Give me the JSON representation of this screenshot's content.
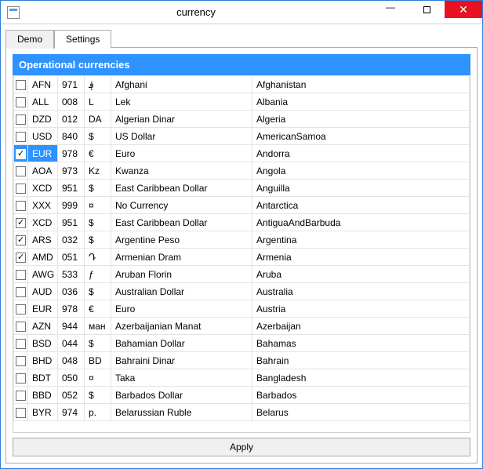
{
  "window": {
    "title": "currency"
  },
  "tabs": {
    "demo": "Demo",
    "settings": "Settings",
    "active": "settings"
  },
  "section": {
    "header": "Operational currencies"
  },
  "buttons": {
    "apply": "Apply"
  },
  "rows": [
    {
      "checked": false,
      "sel": false,
      "code": "AFN",
      "num": "971",
      "sym": "؋",
      "name": "Afghani",
      "country": "Afghanistan"
    },
    {
      "checked": false,
      "sel": false,
      "code": "ALL",
      "num": "008",
      "sym": "L",
      "name": "Lek",
      "country": "Albania"
    },
    {
      "checked": false,
      "sel": false,
      "code": "DZD",
      "num": "012",
      "sym": "DA",
      "name": "Algerian Dinar",
      "country": "Algeria"
    },
    {
      "checked": false,
      "sel": false,
      "code": "USD",
      "num": "840",
      "sym": "$",
      "name": "US Dollar",
      "country": "AmericanSamoa"
    },
    {
      "checked": true,
      "sel": true,
      "code": "EUR",
      "num": "978",
      "sym": "€",
      "name": "Euro",
      "country": "Andorra"
    },
    {
      "checked": false,
      "sel": false,
      "code": "AOA",
      "num": "973",
      "sym": "Kz",
      "name": "Kwanza",
      "country": "Angola"
    },
    {
      "checked": false,
      "sel": false,
      "code": "XCD",
      "num": "951",
      "sym": "$",
      "name": "East Caribbean Dollar",
      "country": "Anguilla"
    },
    {
      "checked": false,
      "sel": false,
      "code": "XXX",
      "num": "999",
      "sym": "¤",
      "name": "No Currency",
      "country": "Antarctica"
    },
    {
      "checked": true,
      "sel": false,
      "code": "XCD",
      "num": "951",
      "sym": "$",
      "name": "East Caribbean Dollar",
      "country": "AntiguaAndBarbuda"
    },
    {
      "checked": true,
      "sel": false,
      "code": "ARS",
      "num": "032",
      "sym": "$",
      "name": "Argentine Peso",
      "country": "Argentina"
    },
    {
      "checked": true,
      "sel": false,
      "code": "AMD",
      "num": "051",
      "sym": "Դ",
      "name": "Armenian Dram",
      "country": "Armenia"
    },
    {
      "checked": false,
      "sel": false,
      "code": "AWG",
      "num": "533",
      "sym": "ƒ",
      "name": "Aruban Florin",
      "country": "Aruba"
    },
    {
      "checked": false,
      "sel": false,
      "code": "AUD",
      "num": "036",
      "sym": "$",
      "name": "Australian Dollar",
      "country": "Australia"
    },
    {
      "checked": false,
      "sel": false,
      "code": "EUR",
      "num": "978",
      "sym": "€",
      "name": "Euro",
      "country": "Austria"
    },
    {
      "checked": false,
      "sel": false,
      "code": "AZN",
      "num": "944",
      "sym": "ман",
      "name": "Azerbaijanian Manat",
      "country": "Azerbaijan"
    },
    {
      "checked": false,
      "sel": false,
      "code": "BSD",
      "num": "044",
      "sym": "$",
      "name": "Bahamian Dollar",
      "country": "Bahamas"
    },
    {
      "checked": false,
      "sel": false,
      "code": "BHD",
      "num": "048",
      "sym": "BD",
      "name": "Bahraini Dinar",
      "country": "Bahrain"
    },
    {
      "checked": false,
      "sel": false,
      "code": "BDT",
      "num": "050",
      "sym": "¤",
      "name": "Taka",
      "country": "Bangladesh"
    },
    {
      "checked": false,
      "sel": false,
      "code": "BBD",
      "num": "052",
      "sym": "$",
      "name": "Barbados Dollar",
      "country": "Barbados"
    },
    {
      "checked": false,
      "sel": false,
      "code": "BYR",
      "num": "974",
      "sym": "p.",
      "name": "Belarussian Ruble",
      "country": "Belarus"
    }
  ]
}
